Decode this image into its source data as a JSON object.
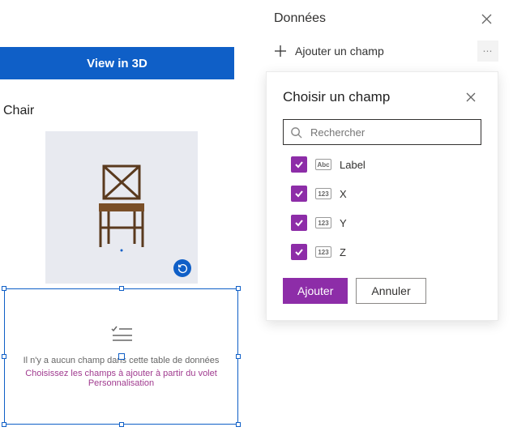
{
  "left": {
    "view_button": "View in 3D",
    "item_title": "Chair",
    "empty_line1": "Il n'y a aucun champ dans cette table de données",
    "empty_line2": "Choisissez les champs à ajouter à partir du volet Personnalisation"
  },
  "panel": {
    "title": "Données",
    "add_field": "Ajouter un champ"
  },
  "dropdown": {
    "title": "Choisir un champ",
    "search_placeholder": "Rechercher",
    "fields": [
      {
        "type": "Abc",
        "label": "Label",
        "checked": true
      },
      {
        "type": "123",
        "label": "X",
        "checked": true
      },
      {
        "type": "123",
        "label": "Y",
        "checked": true
      },
      {
        "type": "123",
        "label": "Z",
        "checked": true
      }
    ],
    "add_btn": "Ajouter",
    "cancel_btn": "Annuler"
  }
}
